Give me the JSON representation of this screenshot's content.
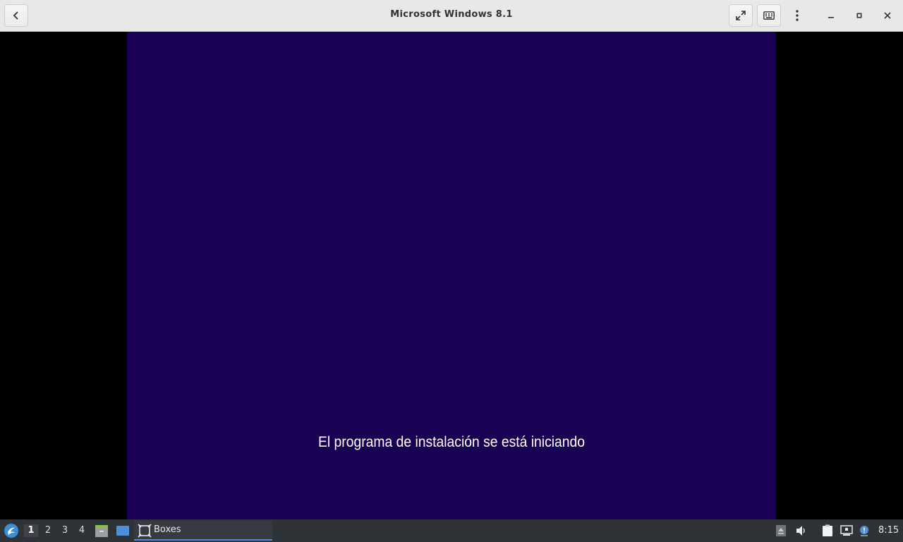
{
  "window": {
    "title": "Microsoft Windows 8.1"
  },
  "titlebar_buttons": {
    "back": "back-arrow-icon",
    "fullscreen": "fullscreen-icon",
    "keyboard": "keyboard-icon",
    "menu": "kebab-menu-icon",
    "minimize": "minimize-icon",
    "maximize": "maximize-icon",
    "close": "close-icon"
  },
  "vm": {
    "status_text": "El programa de instalación se está iniciando",
    "background_color": "#180052"
  },
  "taskbar": {
    "workspaces": [
      "1",
      "2",
      "3",
      "4"
    ],
    "active_workspace": "1",
    "task_label": "Boxes",
    "clock": "8:15"
  },
  "colors": {
    "titlebar_bg": "#e8e8e7",
    "taskbar_bg": "#2e3338",
    "accent": "#4a90d9"
  }
}
